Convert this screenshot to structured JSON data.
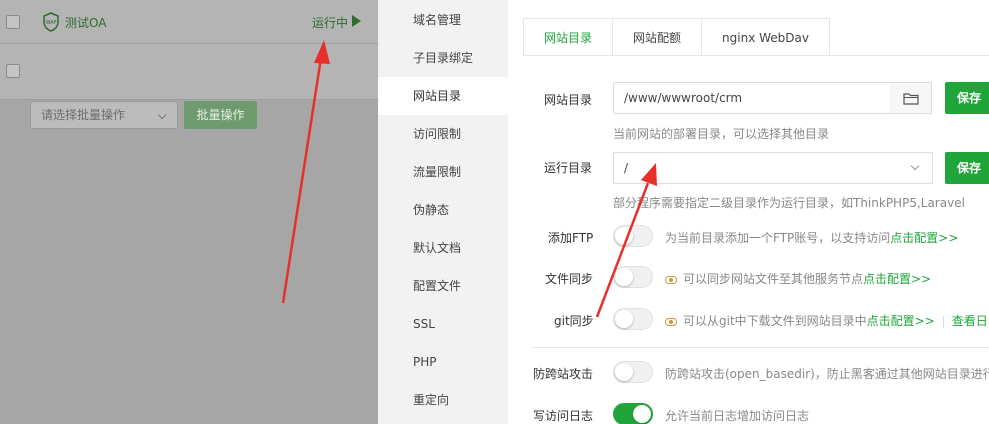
{
  "site_list": {
    "site_name": "测试OA",
    "status": "运行中",
    "batch_select_placeholder": "请选择批量操作",
    "batch_button": "批量操作"
  },
  "nav": {
    "items": [
      {
        "label": "域名管理"
      },
      {
        "label": "子目录绑定"
      },
      {
        "label": "网站目录",
        "active": true
      },
      {
        "label": "访问限制"
      },
      {
        "label": "流量限制"
      },
      {
        "label": "伪静态"
      },
      {
        "label": "默认文档"
      },
      {
        "label": "配置文件"
      },
      {
        "label": "SSL"
      },
      {
        "label": "PHP"
      },
      {
        "label": "重定向"
      }
    ]
  },
  "tabs": [
    {
      "label": "网站目录",
      "active": true
    },
    {
      "label": "网站配额"
    },
    {
      "label": "nginx WebDav"
    }
  ],
  "site_dir": {
    "label": "网站目录",
    "value": "/www/wwwroot/crm",
    "hint": "当前网站的部署目录，可以选择其他目录",
    "save": "保存"
  },
  "run_dir": {
    "label": "运行目录",
    "value": "/",
    "hint": "部分程序需要指定二级目录作为运行目录，如ThinkPHP5,Laravel",
    "save": "保存"
  },
  "toggles": {
    "ftp": {
      "label": "添加FTP",
      "desc": "为当前目录添加一个FTP账号，以支持访问",
      "link": "点击配置>>",
      "on": false
    },
    "sync": {
      "label": "文件同步",
      "desc": "可以同步网站文件至其他服务节点",
      "link": "点击配置>>",
      "on": false
    },
    "git": {
      "label": "git同步",
      "desc": "可以从git中下载文件到网站目录中",
      "link": "点击配置>>",
      "extra": "查看日",
      "on": false
    },
    "anti_cross": {
      "label": "防跨站攻击",
      "desc": "防跨站攻击(open_basedir)，防止黑客通过其他网站目录进行",
      "on": false
    },
    "access_log": {
      "label": "写访问日志",
      "desc": "允许当前日志增加访问日志",
      "on": true
    }
  },
  "colors": {
    "accent": "#20a53a",
    "annotation_arrow": "#e8302a"
  }
}
